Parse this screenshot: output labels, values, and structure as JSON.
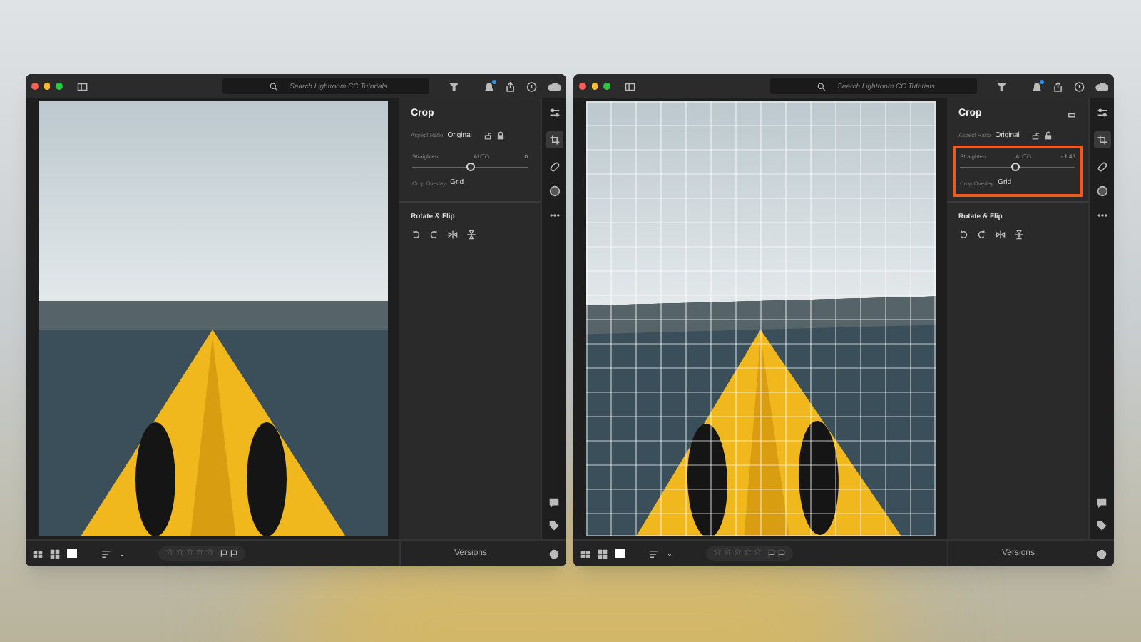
{
  "windows": [
    {
      "search": {
        "placeholder": "Search Lightroom CC Tutorials"
      },
      "notification": true,
      "photo": {
        "rotated": false,
        "grid_overlay": false
      },
      "panel": {
        "title": "Crop",
        "aspect_label": "Aspect Ratio",
        "aspect_value": "Original",
        "straighten_label": "Straighten",
        "auto": "AUTO",
        "straighten_value": "0",
        "level": 0.5,
        "overlay_label": "Crop Overlay",
        "overlay_value": "Grid",
        "highlighted": false,
        "section": "Rotate & Flip",
        "reset_icon": false
      },
      "stars": 0,
      "versions": "Versions"
    },
    {
      "search": {
        "placeholder": "Search Lightroom CC Tutorials"
      },
      "notification": true,
      "photo": {
        "rotated": true,
        "grid_overlay": true
      },
      "panel": {
        "title": "Crop",
        "aspect_label": "Aspect Ratio",
        "aspect_value": "Original",
        "straighten_label": "Straighten",
        "auto": "AUTO",
        "straighten_value": "- 1.46",
        "level": 0.48,
        "overlay_label": "Crop Overlay",
        "overlay_value": "Grid",
        "highlighted": true,
        "section": "Rotate & Flip",
        "reset_icon": true
      },
      "stars": 0,
      "versions": "Versions"
    }
  ]
}
